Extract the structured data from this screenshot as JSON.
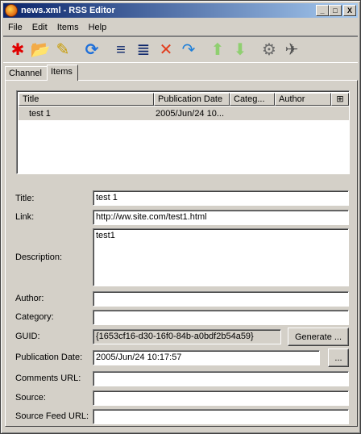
{
  "window": {
    "title": "news.xml - RSS Editor"
  },
  "menu": {
    "file": "File",
    "edit": "Edit",
    "items": "Items",
    "help": "Help"
  },
  "tabs": {
    "channel": "Channel",
    "items": "Items"
  },
  "list": {
    "headers": {
      "title": "Title",
      "pub_date": "Publication Date",
      "category": "Categ...",
      "author": "Author"
    },
    "rows": [
      {
        "title": "test 1",
        "pub_date": "2005/Jun/24 10...",
        "category": "",
        "author": ""
      }
    ]
  },
  "form": {
    "title_label": "Title:",
    "title_value": "test 1",
    "link_label": "Link:",
    "link_value": "http://ww.site.com/test1.html",
    "description_label": "Description:",
    "description_value": "test1",
    "author_label": "Author:",
    "author_value": "",
    "category_label": "Category:",
    "category_value": "",
    "guid_label": "GUID:",
    "guid_value": "{1653cf16-d30-16f0-84b-a0bdf2b54a59}",
    "generate_label": "Generate ...",
    "pubdate_label": "Publication Date:",
    "pubdate_value": "2005/Jun/24 10:17:57",
    "pubdate_button": "...",
    "comments_label": "Comments URL:",
    "comments_value": "",
    "source_label": "Source:",
    "source_value": "",
    "sourcefeed_label": "Source Feed URL:",
    "sourcefeed_value": ""
  },
  "title_controls": {
    "minimize": "_",
    "maximize": "□",
    "close": "X"
  },
  "toolbar_icons": {
    "new": "✱",
    "open": "📂",
    "edit": "✎",
    "refresh": "⟳",
    "add_item": "≡",
    "insert_item": "≣",
    "delete": "✕",
    "undo": "↷",
    "move_up": "⬆",
    "move_down": "⬇",
    "settings": "⚙",
    "publish": "✈"
  }
}
